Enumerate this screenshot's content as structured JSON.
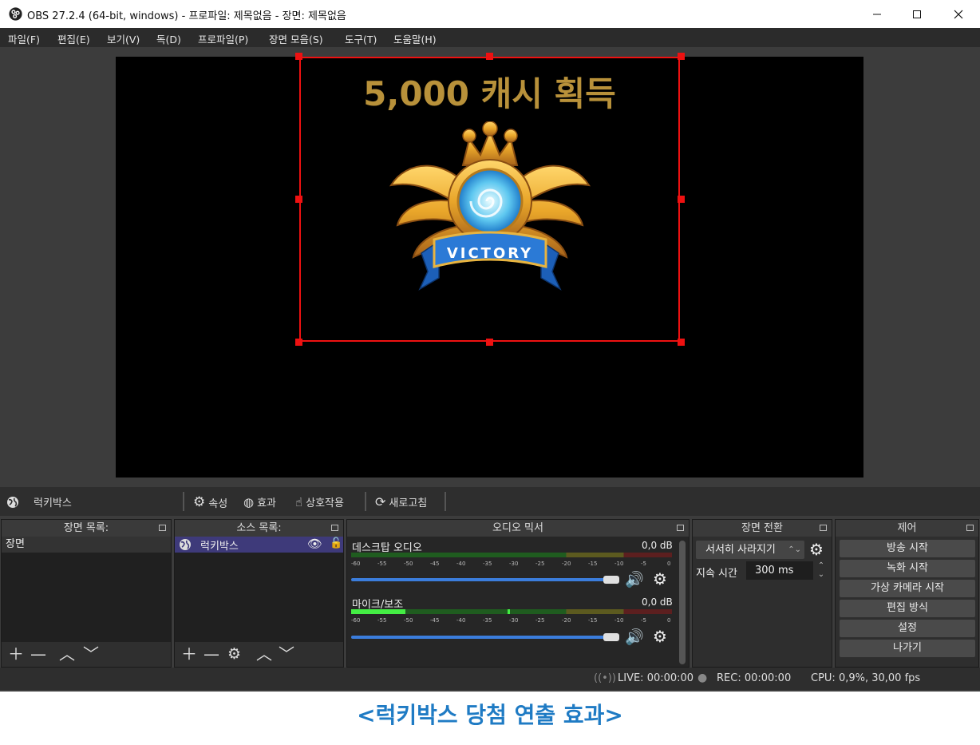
{
  "window": {
    "title": "OBS 27.2.4 (64-bit, windows) - 프로파일: 제목없음 - 장면: 제목없음",
    "controls": {
      "minimize": "minimize-icon",
      "maximize": "maximize-icon",
      "close": "close-icon"
    }
  },
  "menu": [
    "파일(F)",
    "편집(E)",
    "보기(V)",
    "독(D)",
    "프로파일(P)",
    "장면 모음(S)",
    "도구(T)",
    "도움말(H)"
  ],
  "preview": {
    "text": "5,000 캐시 획득",
    "badge_text": "VICTORY"
  },
  "context_bar": {
    "source_name": "럭키박스",
    "properties": "속성",
    "filters": "효과",
    "interact": "상호작용",
    "refresh": "새로고침"
  },
  "scenes": {
    "header": "장면 목록:",
    "items": [
      "장면"
    ]
  },
  "sources": {
    "header": "소스 목록:",
    "items": [
      {
        "name": "럭키박스",
        "visible": true,
        "locked": false
      }
    ]
  },
  "mixer": {
    "header": "오디오 믹서",
    "channels": [
      {
        "name": "데스크탑 오디오",
        "db": "0,0 dB",
        "level": 0.0,
        "volume": 1.0
      },
      {
        "name": "마이크/보조",
        "db": "0,0 dB",
        "level": 0.17,
        "volume": 1.0
      }
    ],
    "ticks": [
      "-60",
      "-55",
      "-50",
      "-45",
      "-40",
      "-35",
      "-30",
      "-25",
      "-20",
      "-15",
      "-10",
      "-5",
      "0"
    ]
  },
  "transitions": {
    "header": "장면 전환",
    "type": "서서히 사라지기",
    "duration_label": "지속 시간",
    "duration_value": "300 ms"
  },
  "controls_dock": {
    "header": "제어",
    "buttons": [
      "방송 시작",
      "녹화 시작",
      "가상 카메라 시작",
      "편집 방식",
      "설정",
      "나가기"
    ]
  },
  "status": {
    "live": "LIVE: 00:00:00",
    "rec": "REC: 00:00:00",
    "cpu": "CPU: 0,9%, 30,00 fps"
  },
  "caption": "<럭키박스 당첨 연출 효과>",
  "colors": {
    "accent": "#3b7ddc",
    "selection": "#ee1111",
    "caption": "#1f7bc4",
    "gold": "#b8913a"
  }
}
